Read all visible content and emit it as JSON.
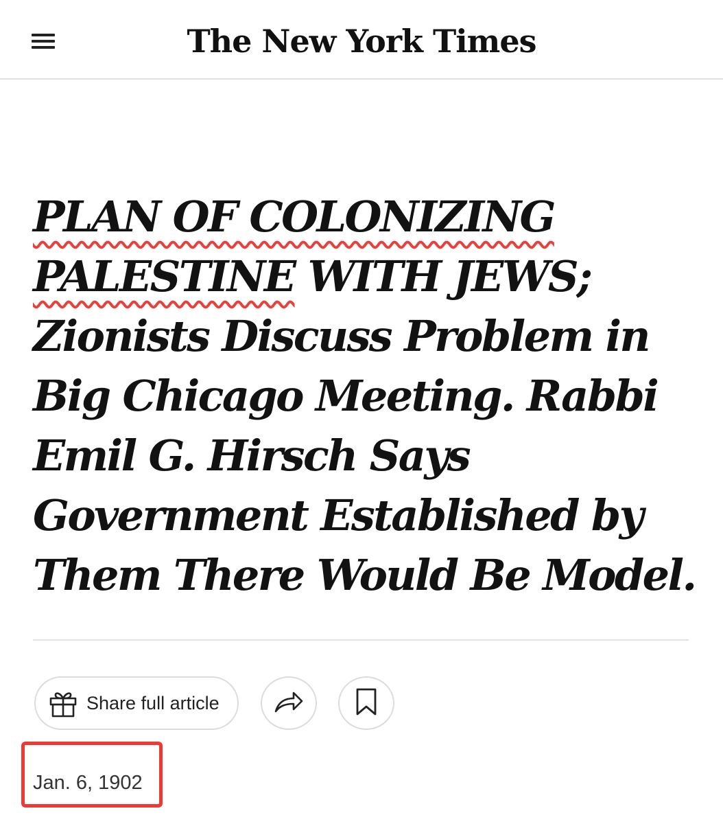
{
  "header": {
    "menu_icon": "hamburger-menu-icon",
    "masthead": "The New York Times"
  },
  "article": {
    "headline_highlight_1": "PLAN OF COLONIZING",
    "headline_highlight_2": "PALESTINE",
    "headline_rest": " WITH JEWS; Zionists Discuss Problem in Big Chicago Meeting. Rabbi Emil G. Hirsch Says Government Established by Them There Would Be Model.",
    "date": "Jan. 6, 1902"
  },
  "actions": {
    "share_full_label": "Share full article",
    "gift_icon": "gift-icon",
    "share_icon": "share-arrow-icon",
    "bookmark_icon": "bookmark-icon"
  },
  "colors": {
    "annotation_red": "#ef3a33",
    "text": "#121212"
  }
}
